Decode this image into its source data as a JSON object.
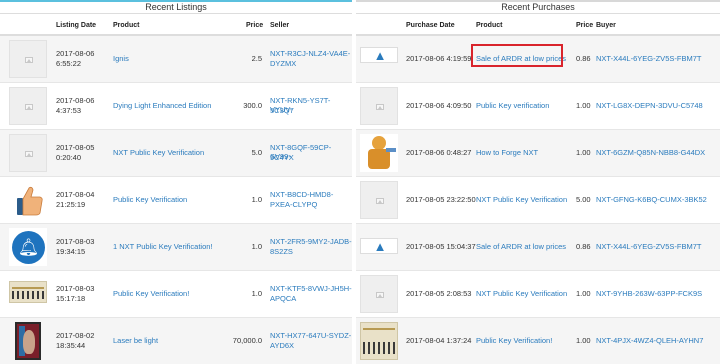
{
  "listings": {
    "title": "Recent Listings",
    "headers": {
      "date": "Listing Date",
      "product": "Product",
      "price": "Price",
      "seller": "Seller"
    },
    "rows": [
      {
        "date1": "2017-08-06",
        "date2": "6:55:22",
        "product": "Ignis",
        "price": "2.5",
        "seller1": "NXT-R3CJ-NLZ4-VA4E-",
        "seller2": "DYZMX",
        "thumb": "placeholder"
      },
      {
        "date1": "2017-08-06",
        "date2": "4:37:53",
        "product": "Dying Light Enhanced Edition",
        "price": "300.0",
        "seller1": "NXT-RKN5-YS7T-VYUV-",
        "seller2": "5C3Q7",
        "thumb": "placeholder"
      },
      {
        "date1": "2017-08-05",
        "date2": "0:20:40",
        "product": "NXT Public Key Verification",
        "price": "5.0",
        "seller1": "NXT-8GQF-59CP-SV99-",
        "seller2": "9C4YX",
        "thumb": "placeholder"
      },
      {
        "date1": "2017-08-04",
        "date2": "21:25:19",
        "product": "Public Key Verification",
        "price": "1.0",
        "seller1": "NXT-B8CD-HMD8-",
        "seller2": "PXEA-CLYPQ",
        "thumb": "thumbs-up"
      },
      {
        "date1": "2017-08-03",
        "date2": "19:34:15",
        "product": "1 NXT Public Key Verification!",
        "price": "1.0",
        "seller1": "NXT-2FR5-9MY2-JADB-",
        "seller2": "8S2ZS",
        "thumb": "bell"
      },
      {
        "date1": "2017-08-03",
        "date2": "15:17:18",
        "product": "Public Key Verification!",
        "price": "1.0",
        "seller1": "NXT-KTF5-8VWJ-JH5H-",
        "seller2": "APQCA",
        "thumb": "poster"
      },
      {
        "date1": "2017-08-02",
        "date2": "18:35:44",
        "product": "Laser be light",
        "price": "70,000.0",
        "seller1": "NXT-HX77-647U-SYDZ-",
        "seller2": "AYD6X",
        "thumb": "painting"
      }
    ]
  },
  "purchases": {
    "title": "Recent Purchases",
    "headers": {
      "date": "Purchase Date",
      "product": "Product",
      "price": "Price",
      "buyer": "Buyer"
    },
    "rows": [
      {
        "date": "2017-08-06 4:19:59",
        "product": "Sale of ARDR at low prices",
        "price": "0.86",
        "buyer": "NXT-X44L-6YEG-ZV5S-FBM7T",
        "thumb": "logo"
      },
      {
        "date": "2017-08-06 4:09:50",
        "product": "Public Key verification",
        "price": "1.00",
        "buyer": "NXT-LG8X-DEPN-3DVU-C5748",
        "thumb": "placeholder"
      },
      {
        "date": "2017-08-06 0:48:27",
        "product": "How to Forge NXT",
        "price": "1.00",
        "buyer": "NXT-6GZM-Q85N-NBB8-G44DX",
        "thumb": "robot"
      },
      {
        "date": "2017-08-05 23:22:50",
        "product": "NXT Public Key Verification",
        "price": "5.00",
        "buyer": "NXT-GFNG-K6BQ-CUMX-3BK52",
        "thumb": "placeholder"
      },
      {
        "date": "2017-08-05 15:04:37",
        "product": "Sale of ARDR at low prices",
        "price": "0.86",
        "buyer": "NXT-X44L-6YEG-ZV5S-FBM7T",
        "thumb": "logo"
      },
      {
        "date": "2017-08-05 2:08:53",
        "product": "NXT Public Key Verification",
        "price": "1.00",
        "buyer": "NXT-9YHB-263W-63PP-FCK9S",
        "thumb": "placeholder"
      },
      {
        "date": "2017-08-04 1:37:24",
        "product": "Public Key Verification!",
        "price": "1.00",
        "buyer": "NXT-4PJX-4WZ4-QLEH-AYHN7",
        "thumb": "poster"
      }
    ]
  },
  "colors": {
    "link": "#2a7bbd",
    "accent": "#5bc0de",
    "highlight": "#d9242c"
  }
}
